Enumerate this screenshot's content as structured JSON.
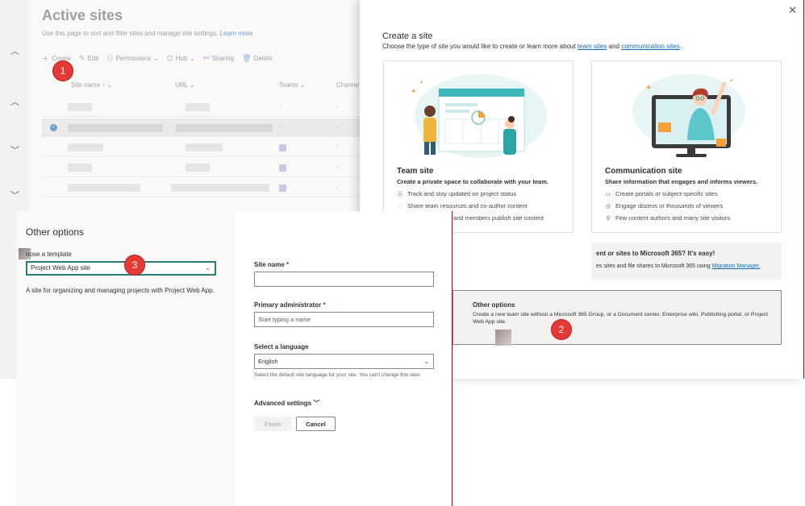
{
  "sites": {
    "title": "Active sites",
    "desc": "Use this page to sort and filter sites and manage site settings.",
    "learn_more": "Learn more",
    "commands": {
      "create": "Create",
      "edit": "Edit",
      "permissions": "Permissions",
      "hub": "Hub",
      "sharing": "Sharing",
      "delete": "Delete"
    },
    "columns": {
      "site_name": "Site name ↑",
      "url": "URL",
      "teams": "Teams",
      "channels": "Channe"
    },
    "row_dash": "-"
  },
  "panel": {
    "close": "✕",
    "title": "Create a site",
    "subtitle_pre": "Choose the type of site you would like to create or learn more about ",
    "team_sites_link": "team sites",
    "subtitle_and": " and ",
    "comm_sites_link": "communication sites",
    "subtitle_end": ".",
    "team": {
      "title": "Team site",
      "desc": "Create a private space to collaborate with your team.",
      "features": [
        "Track and stay updated on project status",
        "Share team resources and co-author content",
        "and members publish site content"
      ]
    },
    "comm": {
      "title": "Communication site",
      "desc": "Share information that engages and informs viewers.",
      "features": [
        "Create portals or subject-specific sites",
        "Engage dozens or thousands of viewers",
        "Few content authors and many site visitors"
      ]
    },
    "migrate": {
      "title": "ent or sites to Microsoft 365? It's easy!",
      "desc": "es sites and file shares to Microsoft 365 using ",
      "link": "Migration Manager."
    },
    "other": {
      "title": "Other options",
      "desc": "Create a new team site without a Microsoft 365 Group, or a Document center, Enterprise wiki, Publishing portal, or Project Web App site."
    }
  },
  "dialog": {
    "title": "Other options",
    "template_label": "oose a template",
    "template_value": "Project Web App site",
    "template_desc": "A site for organizing and managing projects with Project Web App.",
    "site_name_label": "Site name",
    "admin_label": "Primary administrator",
    "admin_placeholder": "Start typing a name",
    "language_label": "Select a language",
    "language_value": "English",
    "language_note": "Select the default site language for your site. You can't change this later.",
    "advanced": "Advanced settings",
    "finish": "Finish",
    "cancel": "Cancel"
  },
  "markers": [
    "1",
    "2",
    "3"
  ],
  "colors": {
    "accent": "#0f6cbd",
    "marker": "#e53935",
    "select_border": "#2b7a7a",
    "highlight_line": "#c00000"
  }
}
